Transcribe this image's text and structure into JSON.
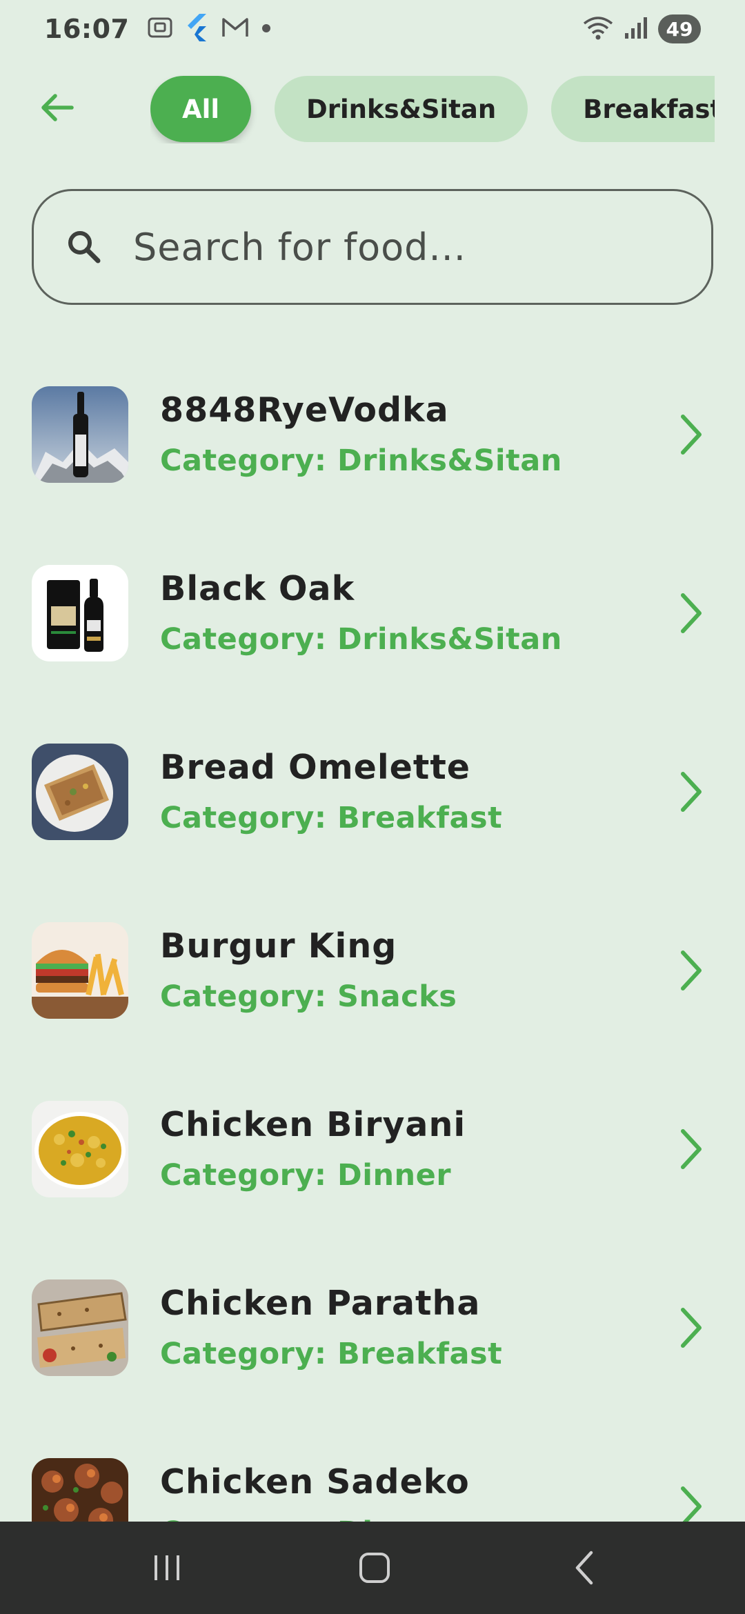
{
  "status_bar": {
    "time": "16:07",
    "battery": "49"
  },
  "top_bar": {
    "back_icon": "arrow-left-icon",
    "chips": [
      {
        "label": "All",
        "active": true
      },
      {
        "label": "Drinks&Sitan",
        "active": false
      },
      {
        "label": "Breakfast",
        "active": false
      }
    ]
  },
  "search": {
    "placeholder": "Search for food...",
    "value": ""
  },
  "food_items": [
    {
      "name": "8848RyeVodka",
      "category": "Category: Drinks&Sitan"
    },
    {
      "name": "Black Oak",
      "category": "Category: Drinks&Sitan"
    },
    {
      "name": "Bread Omelette",
      "category": "Category: Breakfast"
    },
    {
      "name": "Burgur King",
      "category": "Category: Snacks"
    },
    {
      "name": "Chicken Biryani",
      "category": "Category: Dinner"
    },
    {
      "name": "Chicken Paratha",
      "category": "Category: Breakfast"
    },
    {
      "name": "Chicken Sadeko",
      "category": "Category: Dinner"
    }
  ],
  "colors": {
    "accent": "#4caf50",
    "chip_inactive": "#c3e2c4",
    "background": "#e2eee3",
    "nav_bar": "#2d2e2d"
  }
}
